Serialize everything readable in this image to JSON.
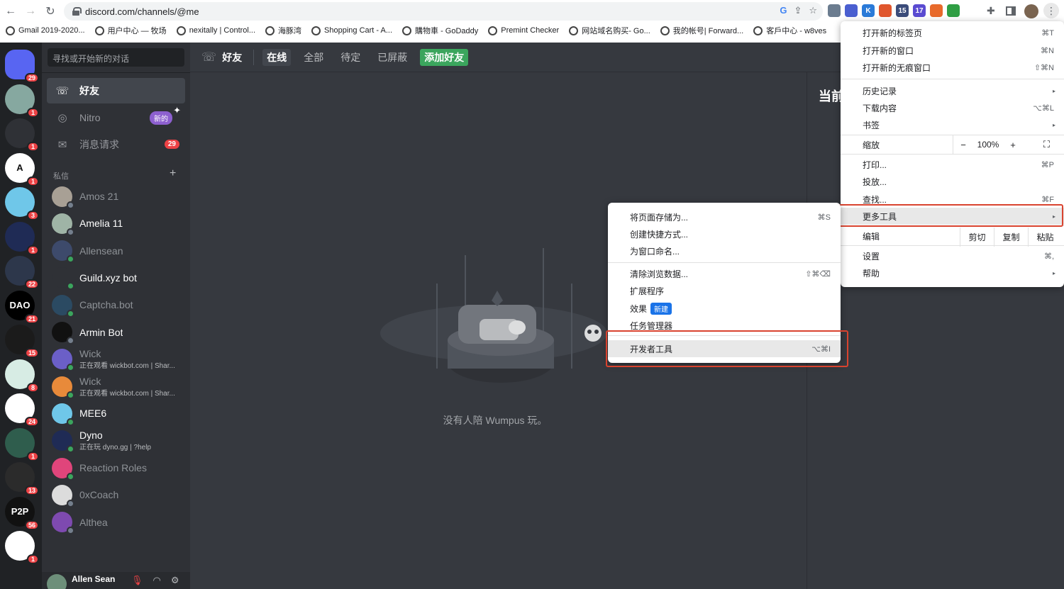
{
  "browser": {
    "url": "discord.com/channels/@me",
    "extensions": [
      {
        "name": "ext-1",
        "color": "#6b7c8f",
        "label": ""
      },
      {
        "name": "ext-2",
        "color": "#4a5fd0",
        "label": ""
      },
      {
        "name": "ext-3",
        "color": "#2a7ad8",
        "label": "K"
      },
      {
        "name": "ext-4",
        "color": "#e0562d",
        "label": ""
      },
      {
        "name": "ext-5",
        "color": "#3b4c7a",
        "label": "15"
      },
      {
        "name": "ext-6",
        "color": "#5a4bd1",
        "label": "17"
      },
      {
        "name": "ext-7",
        "color": "#e86a2b",
        "label": ""
      },
      {
        "name": "ext-8",
        "color": "#2f9e44",
        "label": ""
      }
    ],
    "bookmarks": [
      "Gmail 2019-2020...",
      "用户中心 — 牧场",
      "nexitally | Control...",
      "海豚湾",
      "Shopping Cart - A...",
      "購物車 - GoDaddy",
      "Premint Checker",
      "网站域名购买- Go...",
      "我的帐号| Forward...",
      "客戶中心 - w8ves"
    ]
  },
  "discord": {
    "guilds": [
      {
        "name": "discord-home",
        "color": "#5865f2",
        "label": "",
        "badge": "29"
      },
      {
        "name": "guild-ape",
        "color": "#86a8a0",
        "label": "",
        "badge": "1"
      },
      {
        "name": "guild-pixel",
        "color": "#2f3136",
        "label": "",
        "badge": "1"
      },
      {
        "name": "guild-a",
        "color": "#ffffff",
        "label": "A",
        "badge": "1"
      },
      {
        "name": "guild-mee6",
        "color": "#6fc7e9",
        "label": "",
        "badge": "3"
      },
      {
        "name": "guild-dyno",
        "color": "#1f2b55",
        "label": "",
        "badge": "1"
      },
      {
        "name": "guild-arb",
        "color": "#2d374b",
        "label": "",
        "badge": "22"
      },
      {
        "name": "guild-dao",
        "color": "#000000",
        "label": "DAO",
        "badge": "21"
      },
      {
        "name": "guild-treasure",
        "color": "#1b1b1b",
        "label": "",
        "badge": "15"
      },
      {
        "name": "guild-robot",
        "color": "#d7ece4",
        "label": "",
        "badge": "8"
      },
      {
        "name": "guild-swirl",
        "color": "#ffffff",
        "label": "",
        "badge": "24"
      },
      {
        "name": "guild-santa",
        "color": "#2f5d4d",
        "label": "",
        "badge": "1"
      },
      {
        "name": "guild-crab",
        "color": "#2b2b2b",
        "label": "",
        "badge": "13"
      },
      {
        "name": "guild-p2p",
        "color": "#111111",
        "label": "P2P",
        "badge": "56"
      },
      {
        "name": "guild-q",
        "color": "#ffffff",
        "label": "",
        "badge": "1"
      }
    ],
    "search_placeholder": "寻找或开始新的对话",
    "nav": {
      "friends": "好友",
      "nitro": "Nitro",
      "nitro_badge": "新的",
      "requests": "消息请求",
      "requests_badge": "29"
    },
    "dm_header": "私信",
    "dms": [
      {
        "name": "Amos 21",
        "sub": "",
        "bright": false,
        "online": false,
        "color": "#a8a095"
      },
      {
        "name": "Amelia 11",
        "sub": "",
        "bright": true,
        "online": false,
        "color": "#9fb4a6"
      },
      {
        "name": "Allensean",
        "sub": "",
        "bright": false,
        "online": true,
        "color": "#3d4a6b"
      },
      {
        "name": "Guild.xyz bot",
        "sub": "",
        "bright": true,
        "online": true,
        "color": "#2f3136"
      },
      {
        "name": "Captcha.bot",
        "sub": "",
        "bright": false,
        "online": true,
        "color": "#2b4a62"
      },
      {
        "name": "Armin Bot",
        "sub": "",
        "bright": true,
        "online": false,
        "color": "#111111"
      },
      {
        "name": "Wick",
        "sub": "正在观看 wickbot.com | Shar...",
        "bright": false,
        "online": true,
        "color": "#6b5fc7"
      },
      {
        "name": "Wick",
        "sub": "正在观看 wickbot.com | Shar...",
        "bright": false,
        "online": true,
        "color": "#e88a3a"
      },
      {
        "name": "MEE6",
        "sub": "",
        "bright": true,
        "online": true,
        "color": "#6fc7e9"
      },
      {
        "name": "Dyno",
        "sub": "正在玩 dyno.gg | ?help",
        "bright": true,
        "online": true,
        "color": "#1f2b55"
      },
      {
        "name": "Reaction Roles",
        "sub": "",
        "bright": false,
        "online": true,
        "color": "#e0457b"
      },
      {
        "name": "0xCoach",
        "sub": "",
        "bright": false,
        "online": false,
        "color": "#dcdcdc"
      },
      {
        "name": "Althea",
        "sub": "",
        "bright": false,
        "online": false,
        "color": "#7e4ab0"
      }
    ],
    "user": {
      "name": "Allen Sean"
    },
    "top": {
      "title": "好友",
      "tabs": [
        "在线",
        "全部",
        "待定",
        "已屏蔽"
      ],
      "add": "添加好友"
    },
    "right_title": "当前",
    "empty_text": "没有人陪 Wumpus 玩。"
  },
  "chrome_menu": {
    "items": [
      {
        "label": "打开新的标签页",
        "sc": "⌘T"
      },
      {
        "label": "打开新的窗口",
        "sc": "⌘N"
      },
      {
        "label": "打开新的无痕窗口",
        "sc": "⇧⌘N"
      },
      {
        "label": "历史记录",
        "sc": "▸"
      },
      {
        "label": "下载内容",
        "sc": "⌥⌘L"
      },
      {
        "label": "书签",
        "sc": "▸"
      },
      {
        "label": "打印...",
        "sc": "⌘P"
      },
      {
        "label": "投放...",
        "sc": ""
      },
      {
        "label": "查找...",
        "sc": "⌘F"
      },
      {
        "label": "更多工具",
        "sc": "▸"
      },
      {
        "label": "设置",
        "sc": "⌘,"
      },
      {
        "label": "帮助",
        "sc": "▸"
      }
    ],
    "zoom_label": "缩放",
    "zoom_value": "100%",
    "edit_label": "编辑",
    "edit_buttons": [
      "剪切",
      "复制",
      "粘贴"
    ]
  },
  "more_tools_menu": {
    "items": [
      {
        "label": "将页面存储为...",
        "sc": "⌘S"
      },
      {
        "label": "创建快捷方式...",
        "sc": ""
      },
      {
        "label": "为窗口命名...",
        "sc": ""
      },
      {
        "label": "清除浏览数据...",
        "sc": "⇧⌘⌫"
      },
      {
        "label": "扩展程序",
        "sc": ""
      },
      {
        "label": "效果",
        "sc": "",
        "tag": "新建"
      },
      {
        "label": "任务管理器",
        "sc": ""
      },
      {
        "label": "开发者工具",
        "sc": "⌥⌘I"
      }
    ]
  },
  "highlight_color": "#d9432f"
}
